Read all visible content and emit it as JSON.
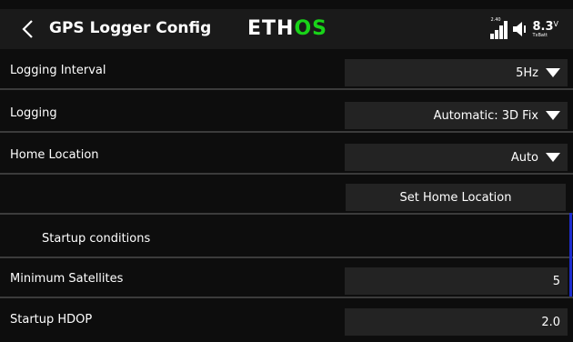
{
  "header": {
    "title": "GPS Logger Config",
    "logo_part1": "ETH",
    "logo_part2": "OS",
    "signal_tag": "2.40",
    "battery_voltage": "8.3",
    "battery_unit": "V",
    "battery_sub": "TxBatt"
  },
  "rows": [
    {
      "label": "Logging Interval",
      "value": "5Hz"
    },
    {
      "label": "Logging",
      "value": "Automatic: 3D Fix"
    },
    {
      "label": "Home Location",
      "value": "Auto"
    },
    {
      "button": "Set Home Location"
    },
    {
      "label": "Startup conditions"
    },
    {
      "label": "Minimum Satellites",
      "value": "5"
    },
    {
      "label": "Startup HDOP",
      "value": "2.0"
    }
  ],
  "icons": {
    "back": "chevron-left-icon",
    "signal": "signal-bars-icon",
    "speaker": "speaker-icon",
    "dropdown": "triangle-down-icon"
  },
  "colors": {
    "background": "#0d0d0d",
    "header": "#1a1a1a",
    "field": "#232323",
    "divider": "#3b3b3b",
    "logo_accent": "#19d319",
    "scroll_indicator": "#1d2ccf"
  }
}
